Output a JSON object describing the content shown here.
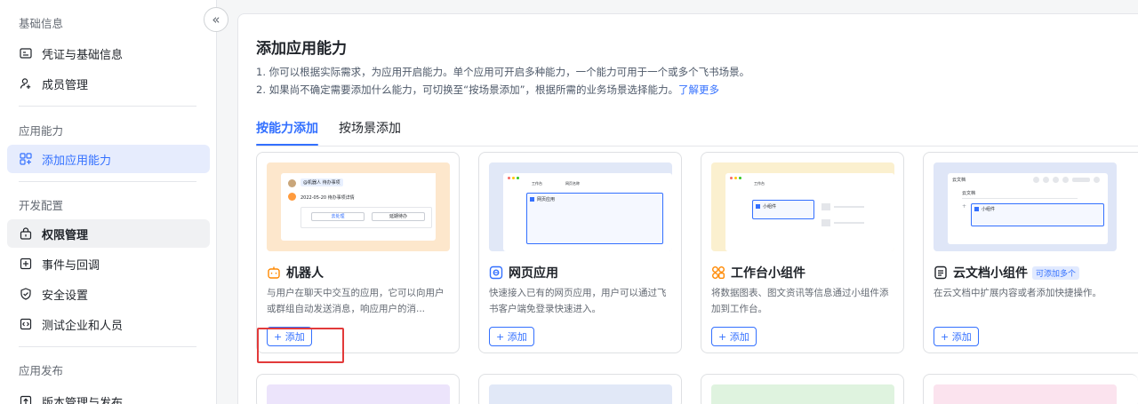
{
  "sidebar": {
    "groups": [
      {
        "title": "基础信息",
        "items": [
          {
            "label": "凭证与基础信息",
            "icon": "id-card-icon"
          },
          {
            "label": "成员管理",
            "icon": "user-add-icon"
          }
        ]
      },
      {
        "title": "应用能力",
        "items": [
          {
            "label": "添加应用能力",
            "icon": "grid-plus-icon"
          }
        ]
      },
      {
        "title": "开发配置",
        "items": [
          {
            "label": "权限管理",
            "icon": "lock-icon"
          },
          {
            "label": "事件与回调",
            "icon": "event-icon"
          },
          {
            "label": "安全设置",
            "icon": "shield-icon"
          },
          {
            "label": "测试企业和人员",
            "icon": "test-icon"
          }
        ]
      },
      {
        "title": "应用发布",
        "items": [
          {
            "label": "版本管理与发布",
            "icon": "upload-icon"
          }
        ]
      }
    ],
    "collapse_glyph": "«"
  },
  "main": {
    "title": "添加应用能力",
    "desc_line1": "1. 你可以根据实际需求，为应用开启能力。单个应用可开启多种能力，一个能力可用于一个或多个飞书场景。",
    "desc_line2": "2. 如果尚不确定需要添加什么能力，可切换至“按场景添加”，根据所需的业务场景选择能力。",
    "learn_more": "了解更多",
    "tabs": [
      "按能力添加",
      "按场景添加"
    ],
    "active_tab": 0
  },
  "cards": [
    {
      "title": "机器人",
      "icon": "robot-icon",
      "desc": "与用户在聊天中交互的应用，它可以向用户或群组自动发送消息，响应用户的消...",
      "add_label": "+ 添加",
      "preview": {
        "chip": "@机器人 待办事项",
        "line": "2022-05-20 待办事项详情",
        "btn1": "去处理",
        "btn2": "延期待办"
      },
      "accent": "#fde7cc"
    },
    {
      "title": "网页应用",
      "icon": "web-app-icon",
      "desc": "快速接入已有的网页应用，用户可以通过飞书客户端免登录快速进入。",
      "add_label": "+ 添加",
      "preview": {
        "tab1": "工作台",
        "tab2": "网页名称",
        "app": "网页应用"
      },
      "accent": "#e1e8f7"
    },
    {
      "title": "工作台小组件",
      "icon": "widget-icon",
      "desc": "将数据图表、图文资讯等信息通过小组件添加到工作台。",
      "add_label": "+ 添加",
      "preview": {
        "tab1": "工作台",
        "widget": "小组件"
      },
      "accent": "#fbf0cf"
    },
    {
      "title": "云文档小组件",
      "icon": "doc-widget-icon",
      "badge": "可添加多个",
      "desc": "在云文档中扩展内容或者添加快捷操作。",
      "add_label": "+ 添加",
      "preview": {
        "header": "云文档",
        "sub": "云文档",
        "widget": "小组件"
      },
      "accent": "#dfe6f7"
    }
  ],
  "colors": {
    "primary": "#3370ff",
    "highlight": "#e23a3a"
  }
}
